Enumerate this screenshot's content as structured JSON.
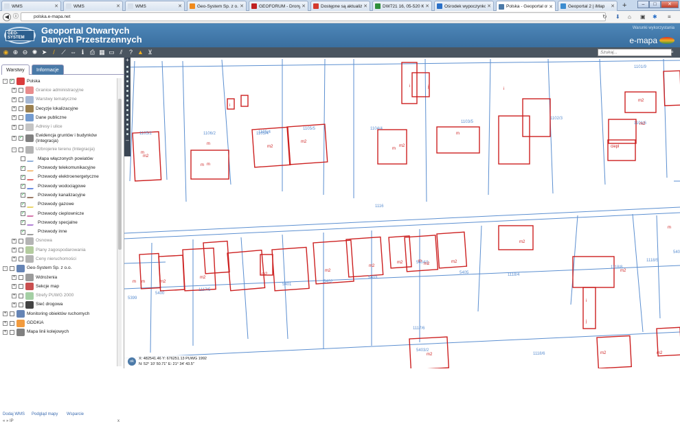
{
  "browser": {
    "tabs": [
      {
        "label": "WMS",
        "color": "#d6dfea"
      },
      {
        "label": "WMS",
        "color": "#d6dfea"
      },
      {
        "label": "WMS",
        "color": "#d6dfea"
      },
      {
        "label": "Geo-System Sp. z o.o.",
        "color": "#f08a1c"
      },
      {
        "label": "GEOFORUM - Drony",
        "color": "#c02020"
      },
      {
        "label": "Dostępne są aktualiz",
        "color": "#d43a2c"
      },
      {
        "label": "DW721 16, 05-520 Ko",
        "color": "#2f8f3a"
      },
      {
        "label": "Ośrodek wypoczynkc",
        "color": "#2a70c8"
      },
      {
        "label": "Polska - Geoportal ot",
        "color": "#4c7aa8"
      },
      {
        "label": "Geoportal 2 | iMap",
        "color": "#3b8cd0"
      }
    ],
    "active_tab_index": 8,
    "url": "polska.e-mapa.net"
  },
  "header": {
    "logo_text": "GEO-SYSTEM",
    "title_line1": "Geoportal Otwartych",
    "title_line2": "Danych Przestrzennych",
    "terms_link": "Warunki wykorzystania",
    "brand": "e-mapa"
  },
  "toolbar": {
    "tools": [
      "layers-icon",
      "zoom-in-icon",
      "zoom-out-icon",
      "zoom-full-icon",
      "pointer-icon",
      "measure-line-icon",
      "measure-path-icon",
      "measure-distance-icon",
      "info-icon",
      "print-icon",
      "table-icon",
      "select-icon",
      "hatch-icon",
      "route-icon",
      "warning-icon",
      "cart-icon"
    ],
    "search_placeholder": "Szukaj..."
  },
  "sidebar": {
    "tabs": [
      "Warstwy",
      "Informacje"
    ],
    "active_tab": 0,
    "layers": [
      {
        "label": "Polska",
        "level": 0,
        "expand": "-",
        "checked": true,
        "dim": false,
        "icon_color": "#d41a1a"
      },
      {
        "label": "Granice administracyjne",
        "level": 1,
        "expand": "+",
        "checked": false,
        "dim": true,
        "icon_color": "#d41a1a"
      },
      {
        "label": "Warstwy tematyczne",
        "level": 1,
        "expand": "+",
        "checked": false,
        "dim": true,
        "icon_color": "#4a6fa8"
      },
      {
        "label": "Decyzje lokalizacyjne",
        "level": 1,
        "expand": "+",
        "checked": false,
        "dim": false,
        "icon_color": "#8a6a30"
      },
      {
        "label": "Dane publiczne",
        "level": 1,
        "expand": "+",
        "checked": false,
        "dim": false,
        "icon_color": "#5a8ac8"
      },
      {
        "label": "Adresy i ulice",
        "level": 1,
        "expand": "+",
        "checked": false,
        "dim": true,
        "icon_color": "#8a8a8a"
      },
      {
        "label": "Ewidencja gruntów i budynków",
        "label2": "(Integracja)",
        "level": 1,
        "expand": "+",
        "checked": true,
        "dim": false,
        "icon_color": "#6a6a6a"
      },
      {
        "label": "Uzbrojenie terenu (Integracja)",
        "level": 1,
        "expand": "-",
        "checked": false,
        "dim": true,
        "icon_color": "#6a6a6a"
      },
      {
        "label": "Mapa włączonych powiatów",
        "level": 2,
        "expand": "",
        "checked": false,
        "dim": false,
        "icon_color": "#5a8ac8"
      },
      {
        "label": "Przewody telekomunikacyjne",
        "level": 2,
        "expand": "",
        "checked": true,
        "dim": false,
        "icon_color": "#f0a040"
      },
      {
        "label": "Przewody elektroenergetyczne",
        "level": 2,
        "expand": "",
        "checked": true,
        "dim": false,
        "icon_color": "#d02020"
      },
      {
        "label": "Przewody wodociągowe",
        "level": 2,
        "expand": "",
        "checked": true,
        "dim": false,
        "icon_color": "#2050d0"
      },
      {
        "label": "Przewody kanalizacyjne",
        "level": 2,
        "expand": "",
        "checked": true,
        "dim": false,
        "icon_color": "#6a3a1a"
      },
      {
        "label": "Przewody gazowe",
        "level": 2,
        "expand": "",
        "checked": true,
        "dim": false,
        "icon_color": "#e0c020"
      },
      {
        "label": "Przewody cieplownicze",
        "level": 2,
        "expand": "",
        "checked": true,
        "dim": false,
        "icon_color": "#c03080"
      },
      {
        "label": "Przewody specjalne",
        "level": 2,
        "expand": "",
        "checked": true,
        "dim": false,
        "icon_color": "#8a40c0"
      },
      {
        "label": "Przewody inne",
        "level": 2,
        "expand": "",
        "checked": true,
        "dim": false,
        "icon_color": "#6a6a6a"
      },
      {
        "label": "Osnowa",
        "level": 1,
        "expand": "+",
        "checked": false,
        "dim": true,
        "icon_color": "#6a6a6a"
      },
      {
        "label": "Plany zagospodarowania",
        "level": 1,
        "expand": "+",
        "checked": false,
        "dim": true,
        "icon_color": "#6a9a40"
      },
      {
        "label": "Ceny nieruchomości",
        "level": 1,
        "expand": "+",
        "checked": false,
        "dim": true,
        "icon_color": "#6a6a6a"
      },
      {
        "label": "Geo-System Sp. z o.o.",
        "level": 0,
        "expand": "-",
        "checked": false,
        "dim": false,
        "icon_color": "#4a6fa8"
      },
      {
        "label": "Wdrożenia",
        "level": 1,
        "expand": "+",
        "checked": false,
        "dim": false,
        "icon_color": "#8a8a8a"
      },
      {
        "label": "Sekcje map",
        "level": 1,
        "expand": "+",
        "checked": false,
        "dim": false,
        "icon_color": "#c03030"
      },
      {
        "label": "Strefy PUWG 2000",
        "level": 1,
        "expand": "+",
        "checked": false,
        "dim": true,
        "icon_color": "#4aa04a"
      },
      {
        "label": "Sieć drogowa",
        "level": 1,
        "expand": "+",
        "checked": false,
        "dim": false,
        "icon_color": "#222222"
      },
      {
        "label": "Monitoring obiektów ruchomych",
        "level": 0,
        "expand": "+",
        "checked": false,
        "dim": false,
        "icon_color": "#4a6fa8"
      },
      {
        "label": "GDDKiA",
        "level": 0,
        "expand": "+",
        "checked": false,
        "dim": false,
        "icon_color": "#f08a1c"
      },
      {
        "label": "Mapa linii kolejowych",
        "level": 0,
        "expand": "+",
        "checked": false,
        "dim": false,
        "icon_color": "#6a6a6a"
      }
    ],
    "footer_links": [
      "Dodaj WMS",
      "Podgląd mapy",
      "Wsparcie"
    ],
    "footer_nav": "«  »  IP",
    "footer_close": "x"
  },
  "map": {
    "labels": [
      "1105/2",
      "1105/4",
      "1106/2",
      "1105/4",
      "1105/5",
      "1104/4",
      "1103/5",
      "1102/3",
      "1101/9",
      "1101/6",
      "1116",
      "5401",
      "5402",
      "5403",
      "5404/1",
      "5405",
      "5399",
      "5400",
      "1117/5",
      "1118/4",
      "1118/8",
      "1118/5",
      "5406",
      "5403/2",
      "1117/6",
      "1118/6"
    ],
    "building_labels": [
      "m",
      "m2",
      "i",
      "j",
      "ciepl"
    ],
    "status_line1": "X: 482541.46   Y: 676251.13   PUWG 1992",
    "status_line2": "N: 52° 10' 50.71\"   E: 21° 34' 43.5\"",
    "ok_label": "ok"
  }
}
